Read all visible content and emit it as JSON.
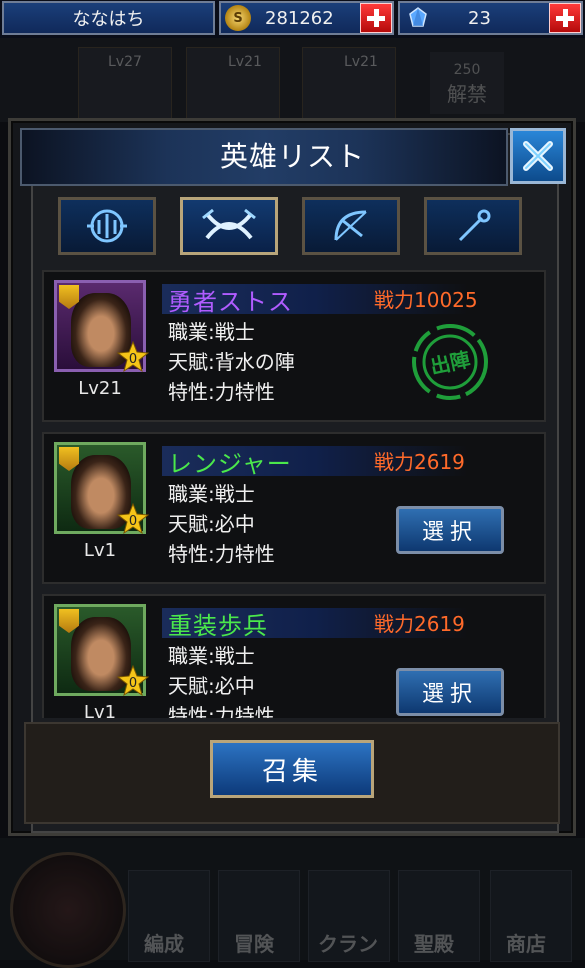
{
  "topbar": {
    "player_name": "ななはち",
    "gold": "281262",
    "gems": "23"
  },
  "background": {
    "cards": [
      {
        "lv": "Lv27"
      },
      {
        "lv": "Lv21"
      },
      {
        "lv": "Lv21"
      }
    ],
    "unlock_count": "250",
    "unlock_label": "解禁",
    "nav": [
      "編成",
      "冒険",
      "クラン",
      "聖殿",
      "商店"
    ]
  },
  "modal": {
    "title": "英雄リスト",
    "filters": [
      {
        "icon": "shield-icon",
        "active": false
      },
      {
        "icon": "crossed-swords-icon",
        "active": true
      },
      {
        "icon": "bow-icon",
        "active": false
      },
      {
        "icon": "staff-icon",
        "active": false
      }
    ],
    "heroes": [
      {
        "name": "勇者ストス",
        "power": "戦力10025",
        "job": "職業:戦士",
        "talent": "天賦:背水の陣",
        "trait": "特性:力特性",
        "lv": "Lv21",
        "stars": "0",
        "status": "出陣",
        "color": "#b05cff"
      },
      {
        "name": "レンジャー",
        "power": "戦力2619",
        "job": "職業:戦士",
        "talent": "天賦:必中",
        "trait": "特性:力特性",
        "lv": "Lv1",
        "stars": "0",
        "action": "選択",
        "color": "#4be84b"
      },
      {
        "name": "重装歩兵",
        "power": "戦力2619",
        "job": "職業:戦士",
        "talent": "天賦:必中",
        "trait": "特性:力特性",
        "lv": "Lv1",
        "stars": "0",
        "action": "選択",
        "color": "#4be84b"
      }
    ],
    "summon_label": "召集"
  }
}
